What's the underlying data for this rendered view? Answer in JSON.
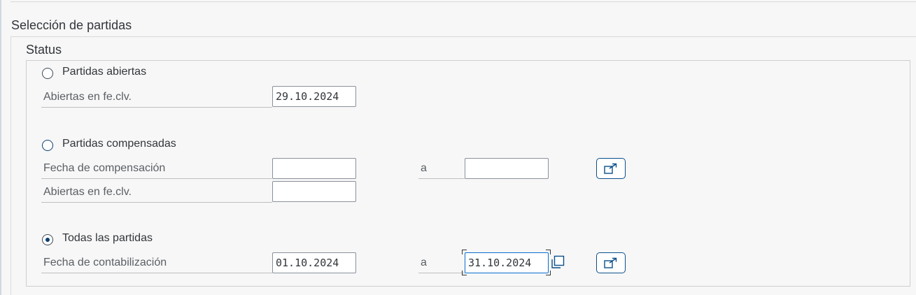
{
  "section": {
    "title": "Selección de partidas"
  },
  "group": {
    "title": "Status"
  },
  "open_items": {
    "radio_label": "Partidas abiertas",
    "key_date_label": "Abiertas en fe.clv.",
    "key_date_value": "29.10.2024",
    "selected": false
  },
  "cleared_items": {
    "radio_label": "Partidas compensadas",
    "clearing_date_label": "Fecha de compensación",
    "clearing_from": "",
    "to_label": "a",
    "clearing_to": "",
    "key_date_label": "Abiertas en fe.clv.",
    "key_date_value": "",
    "selected": false
  },
  "all_items": {
    "radio_label": "Todas las partidas",
    "posting_date_label": "Fecha de contabilización",
    "posting_from": "01.10.2024",
    "to_label": "a",
    "posting_to": "31.10.2024",
    "selected": true
  },
  "icons": {
    "multiple_selection": "multiple-selection-arrow-icon",
    "value_help": "value-help-icon"
  },
  "colors": {
    "accent": "#0a3f73",
    "focus": "#0a6ed1"
  }
}
